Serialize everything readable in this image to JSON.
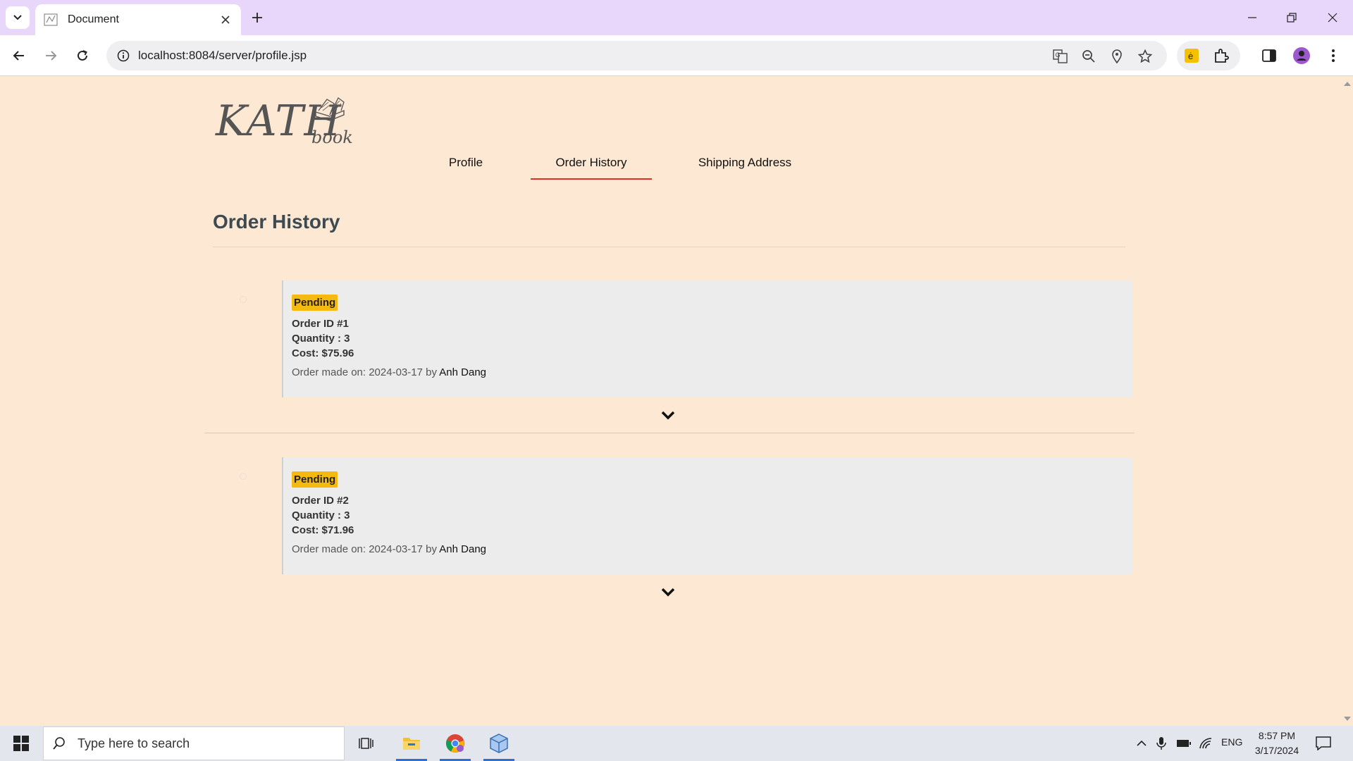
{
  "browser": {
    "tab_title": "Document",
    "url": "localhost:8084/server/profile.jsp"
  },
  "site": {
    "logo_text": "KATH",
    "logo_sub": "book"
  },
  "nav": {
    "items": [
      {
        "label": "Profile"
      },
      {
        "label": "Order History"
      },
      {
        "label": "Shipping Address"
      }
    ],
    "active": "Order History"
  },
  "page": {
    "title": "Order History"
  },
  "orders": [
    {
      "status": "Pending",
      "order_id": "Order ID #1",
      "quantity": "Quantity : 3",
      "cost": "Cost: $75.96",
      "meta_prefix": "Order made on: 2024-03-17 by ",
      "user": "Anh Dang"
    },
    {
      "status": "Pending",
      "order_id": "Order ID #2",
      "quantity": "Quantity : 3",
      "cost": "Cost: $71.96",
      "meta_prefix": "Order made on: 2024-03-17 by ",
      "user": "Anh Dang"
    }
  ],
  "colors": {
    "page_bg": "#fde8d4",
    "badge": "#f5b90f",
    "active_tab_underline": "#d9302a",
    "card_bg": "#ececec"
  },
  "taskbar": {
    "search_placeholder": "Type here to search",
    "language": "ENG",
    "time": "8:57 PM",
    "date": "3/17/2024"
  }
}
